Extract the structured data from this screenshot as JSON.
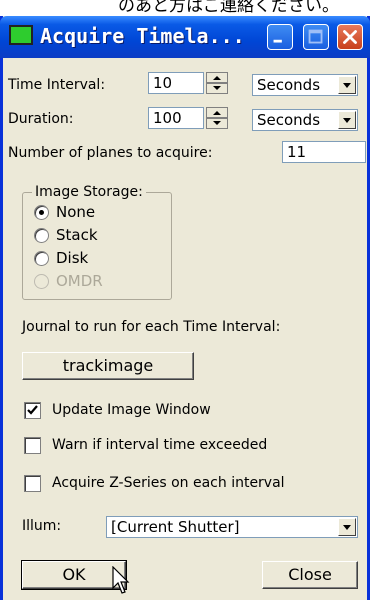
{
  "top_strip_text": "のあと方はご連絡ください。",
  "window": {
    "title": "Acquire Timela..."
  },
  "title_buttons": {
    "minimize": "minimize-icon",
    "maximize": "maximize-icon",
    "close": "close-icon"
  },
  "time_interval": {
    "label": "Time Interval:",
    "value": "10",
    "unit": "Seconds"
  },
  "duration": {
    "label": "Duration:",
    "value": "100",
    "unit": "Seconds"
  },
  "planes": {
    "label": "Number of planes to acquire:",
    "value": "11"
  },
  "image_storage": {
    "title": "Image Storage:",
    "options": [
      {
        "label": "None",
        "selected": true,
        "enabled": true
      },
      {
        "label": "Stack",
        "selected": false,
        "enabled": true
      },
      {
        "label": "Disk",
        "selected": false,
        "enabled": true
      },
      {
        "label": "OMDR",
        "selected": false,
        "enabled": false
      }
    ]
  },
  "journal": {
    "label": "Journal to run for each Time Interval:",
    "button": "trackimage"
  },
  "checkboxes": [
    {
      "label": "Update Image Window",
      "checked": true
    },
    {
      "label": "Warn if interval time exceeded",
      "checked": false
    },
    {
      "label": "Acquire Z-Series on each interval",
      "checked": false
    }
  ],
  "illum": {
    "label": "Illum:",
    "value": "[Current Shutter]"
  },
  "buttons": {
    "ok": "OK",
    "close": "Close"
  },
  "colors": {
    "titlebar": "#0a5ae6",
    "window_bg": "#ece9d8",
    "close_button": "#d9542c",
    "app_icon": "#2ecc2e"
  }
}
